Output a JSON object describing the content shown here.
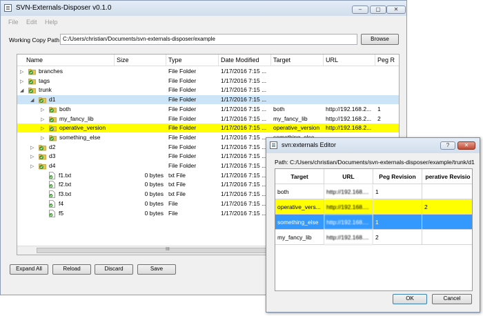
{
  "main_window": {
    "title": "SVN-Externals-Disposer v0.1.0",
    "controls": {
      "minimize": "–",
      "maximize": "▢",
      "close": "✕"
    },
    "menu": [
      "File",
      "Edit",
      "Help"
    ],
    "working_copy_label": "Working Copy Path",
    "working_copy_path": "C:/Users/christian/Documents/svn-externals-disposer/example",
    "browse_label": "Browse",
    "columns": [
      "Name",
      "Size",
      "Type",
      "Date Modified",
      "Target",
      "URL",
      "Peg R"
    ],
    "rows": [
      {
        "name": "branches",
        "size": "",
        "type": "File Folder",
        "date": "1/17/2016 7:15 ...",
        "target": "",
        "url": "",
        "peg": "",
        "expander": "▷"
      },
      {
        "name": "tags",
        "size": "",
        "type": "File Folder",
        "date": "1/17/2016 7:15 ...",
        "target": "",
        "url": "",
        "peg": "",
        "expander": "▷"
      },
      {
        "name": "trunk",
        "size": "",
        "type": "File Folder",
        "date": "1/17/2016 7:15 ...",
        "target": "",
        "url": "",
        "peg": "",
        "expander": "◢"
      },
      {
        "name": "d1",
        "size": "",
        "type": "File Folder",
        "date": "1/17/2016 7:15 ...",
        "target": "",
        "url": "",
        "peg": "",
        "expander": "◢"
      },
      {
        "name": "both",
        "size": "",
        "type": "File Folder",
        "date": "1/17/2016 7:15 ...",
        "target": "both",
        "url": "http://192.168.2...",
        "peg": "1",
        "expander": "▷"
      },
      {
        "name": "my_fancy_lib",
        "size": "",
        "type": "File Folder",
        "date": "1/17/2016 7:15 ...",
        "target": "my_fancy_lib",
        "url": "http://192.168.2...",
        "peg": "2",
        "expander": "▷"
      },
      {
        "name": "operative_version",
        "size": "",
        "type": "File Folder",
        "date": "1/17/2016 7:15 ...",
        "target": "operative_version",
        "url": "http://192.168.2...",
        "peg": "",
        "expander": "▷"
      },
      {
        "name": "something_else",
        "size": "",
        "type": "File Folder",
        "date": "1/17/2016 7:15 ...",
        "target": "something_else",
        "url": "",
        "peg": "",
        "expander": "▷"
      },
      {
        "name": "d2",
        "size": "",
        "type": "File Folder",
        "date": "1/17/2016 7:15 ...",
        "target": "",
        "url": "",
        "peg": "",
        "expander": "▷"
      },
      {
        "name": "d3",
        "size": "",
        "type": "File Folder",
        "date": "1/17/2016 7:15 ...",
        "target": "",
        "url": "",
        "peg": "",
        "expander": "▷"
      },
      {
        "name": "d4",
        "size": "",
        "type": "File Folder",
        "date": "1/17/2016 7:15 ...",
        "target": "",
        "url": "",
        "peg": "",
        "expander": "▷"
      },
      {
        "name": "f1.txt",
        "size": "0 bytes",
        "type": "txt File",
        "date": "1/17/2016 7:15 ...",
        "target": "",
        "url": "",
        "peg": "",
        "expander": ""
      },
      {
        "name": "f2.txt",
        "size": "0 bytes",
        "type": "txt File",
        "date": "1/17/2016 7:15 ...",
        "target": "",
        "url": "",
        "peg": "",
        "expander": ""
      },
      {
        "name": "f3.txt",
        "size": "0 bytes",
        "type": "txt File",
        "date": "1/17/2016 7:15 ...",
        "target": "",
        "url": "",
        "peg": "",
        "expander": ""
      },
      {
        "name": "f4",
        "size": "0 bytes",
        "type": "File",
        "date": "1/17/2016 7:15 ...",
        "target": "",
        "url": "",
        "peg": "",
        "expander": ""
      },
      {
        "name": "f5",
        "size": "0 bytes",
        "type": "File",
        "date": "1/17/2016 7:15 ...",
        "target": "",
        "url": "",
        "peg": "",
        "expander": ""
      }
    ],
    "scroll_grip": "III",
    "buttons": {
      "expand_all": "Expand All",
      "reload": "Reload",
      "discard": "Discard",
      "save": "Save"
    }
  },
  "dialog": {
    "title": "svn:externals Editor",
    "controls": {
      "help": "?",
      "close": "✕"
    },
    "path_label": "Path:",
    "path_value": "C:/Users/christian/Documents/svn-externals-disposer/example/trunk/d1",
    "columns": [
      "Target",
      "URL",
      "Peg Revision",
      "perative Revisio"
    ],
    "rows": [
      {
        "target": "both",
        "url": "http://192.168....",
        "peg": "1",
        "op": ""
      },
      {
        "target": "operative_vers...",
        "url": "http://192.168....",
        "peg": "",
        "op": "2"
      },
      {
        "target": "something_else",
        "url": "http://192.168....",
        "peg": "1",
        "op": ""
      },
      {
        "target": "my_fancy_lib",
        "url": "http://192.168....",
        "peg": "2",
        "op": ""
      }
    ],
    "ok_label": "OK",
    "cancel_label": "Cancel"
  },
  "colors": {
    "highlight": "#ffff00",
    "selected": "#3399ff",
    "tree_selected": "#cce4f7",
    "folder": "#e8c454",
    "svn_badge": "#3a9a2a"
  }
}
